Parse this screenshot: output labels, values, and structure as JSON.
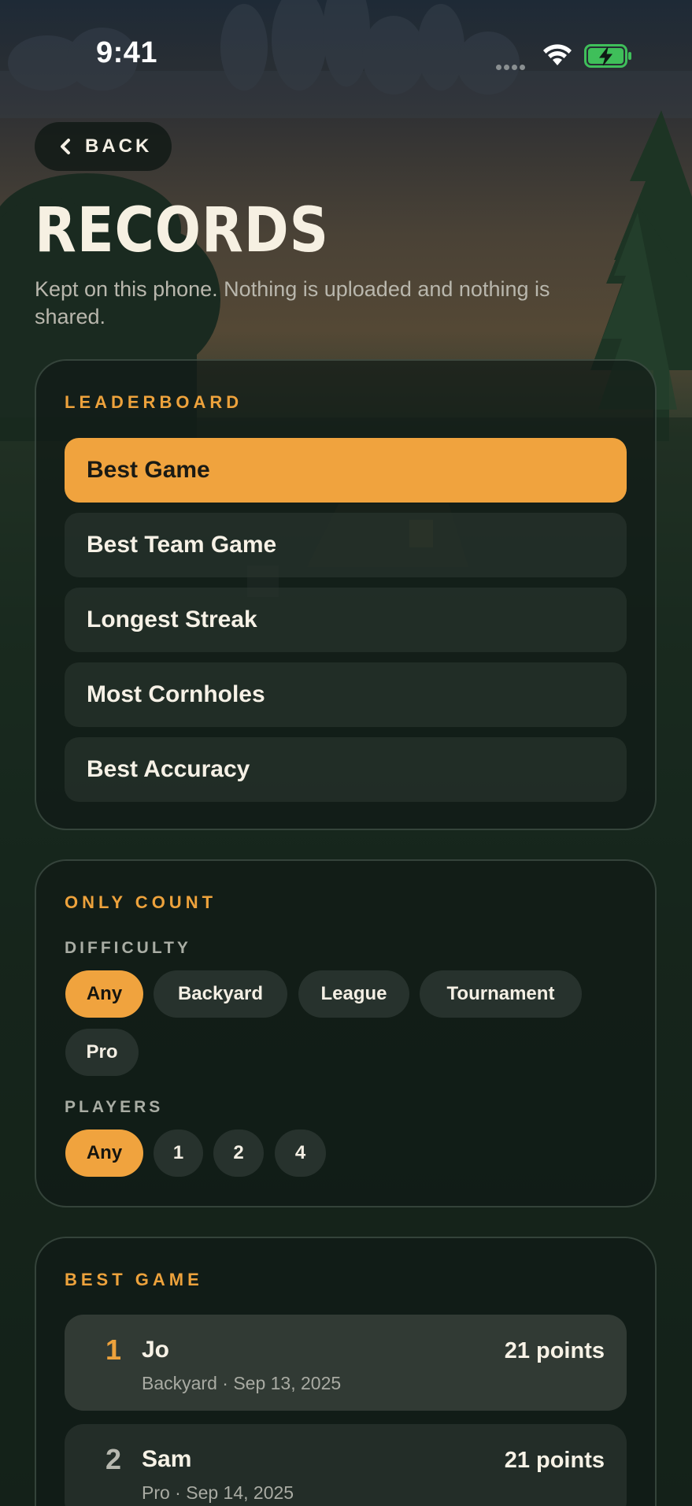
{
  "status_bar": {
    "time": "9:41"
  },
  "nav": {
    "back_label": "BACK"
  },
  "header": {
    "title": "RECORDS",
    "subtitle": "Kept on this phone. Nothing is uploaded and nothing is shared."
  },
  "leaderboard": {
    "label": "LEADERBOARD",
    "selected": "Best Game",
    "items": [
      {
        "label": "Best Game"
      },
      {
        "label": "Best Team Game"
      },
      {
        "label": "Longest Streak"
      },
      {
        "label": "Most Cornholes"
      },
      {
        "label": "Best Accuracy"
      }
    ]
  },
  "filters": {
    "label": "ONLY COUNT",
    "difficulty": {
      "label": "DIFFICULTY",
      "selected": "Any",
      "options": [
        "Any",
        "Backyard",
        "League",
        "Tournament",
        "Pro"
      ]
    },
    "players": {
      "label": "PLAYERS",
      "selected": "Any",
      "options": [
        "Any",
        "1",
        "2",
        "4"
      ]
    }
  },
  "results": {
    "label": "BEST GAME",
    "entries": [
      {
        "rank": "1",
        "name": "Jo",
        "meta": "Backyard · Sep 13, 2025",
        "score": "21 points"
      },
      {
        "rank": "2",
        "name": "Sam",
        "meta": "Pro · Sep 14, 2025",
        "score": "21 points"
      }
    ]
  },
  "colors": {
    "accent": "#f0a33e",
    "background": "#101a15",
    "text": "#f4efe4"
  }
}
